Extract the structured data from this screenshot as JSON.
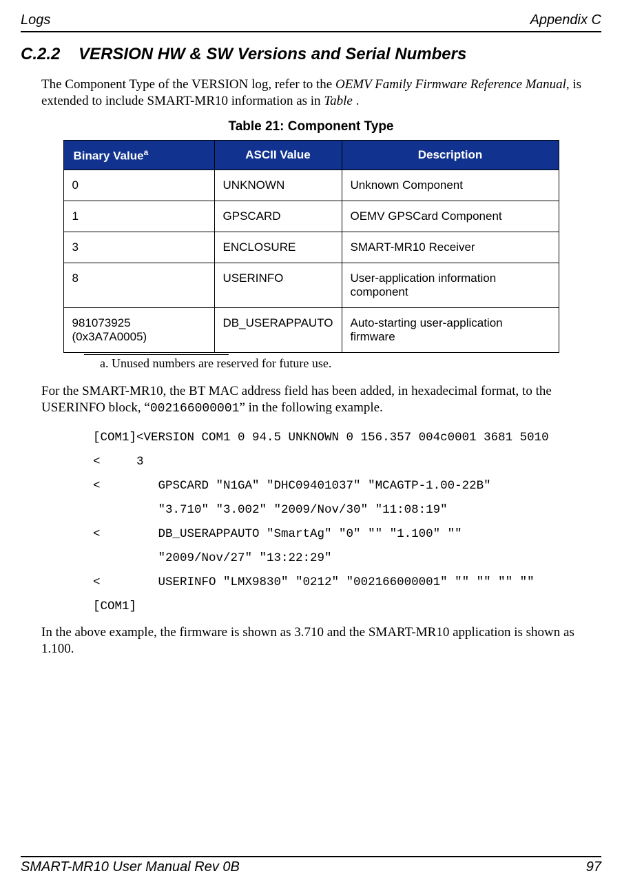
{
  "header": {
    "left": "Logs",
    "right": "Appendix C"
  },
  "section": {
    "number": "C.2.2",
    "title": "VERSION   HW & SW Versions and Serial Numbers"
  },
  "intro": {
    "pre": "The Component Type of the VERSION log, refer to the ",
    "em1": "OEMV Family Firmware Reference Manual",
    "mid": ", is extended to include SMART-MR10 information as in ",
    "em2": "Table ",
    "post": "."
  },
  "table": {
    "caption": "Table 21:  Component Type",
    "headers": {
      "c1": "Binary Value",
      "c1sup": "a",
      "c2": "ASCII Value",
      "c3": "Description"
    },
    "rows": [
      {
        "c1": "0",
        "c2": "UNKNOWN",
        "c3": "Unknown Component"
      },
      {
        "c1": "1",
        "c2": "GPSCARD",
        "c3": "OEMV GPSCard Component"
      },
      {
        "c1": "3",
        "c2": "ENCLOSURE",
        "c3": "SMART-MR10 Receiver"
      },
      {
        "c1": "8",
        "c2": "USERINFO",
        "c3": "User-application information component"
      },
      {
        "c1": "981073925 (0x3A7A0005)",
        "c2": "DB_USERAPPAUTO",
        "c3": "Auto-starting user-application firmware"
      }
    ],
    "footnote": "a.  Unused numbers are reserved for future use."
  },
  "para2": {
    "pre": "For the SMART-MR10, the BT MAC address field has been added, in hexadecimal format, to the USERINFO block, “",
    "code": "002166000001",
    "post": "” in the following example."
  },
  "code": {
    "l1": "[COM1]<VERSION COM1 0 94.5 UNKNOWN 0 156.357 004c0001 3681 5010",
    "l2": "<     3",
    "l3": "<        GPSCARD \"N1GA\" \"DHC09401037\" \"MCAGTP-1.00-22B\"",
    "l4": "         \"3.710\" \"3.002\" \"2009/Nov/30\" \"11:08:19\"",
    "l5": "<        DB_USERAPPAUTO \"SmartAg\" \"0\" \"\" \"1.100\" \"\"",
    "l6": "         \"2009/Nov/27\" \"13:22:29\"",
    "l7": "<        USERINFO \"LMX9830\" \"0212\" \"002166000001\" \"\" \"\" \"\" \"\"",
    "l8": "[COM1]"
  },
  "para3": "In the above example, the firmware is shown as 3.710 and the SMART-MR10 application is shown as 1.100.",
  "footer": {
    "left": "SMART-MR10 User Manual Rev 0B",
    "right": "97"
  }
}
